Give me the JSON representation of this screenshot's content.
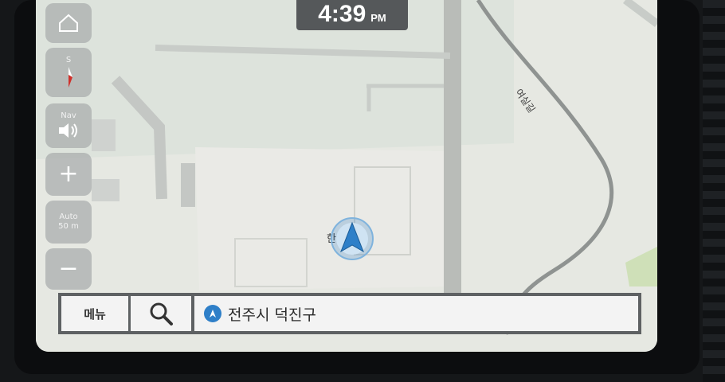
{
  "status_bar": {
    "time": "4:39",
    "ampm": "PM"
  },
  "controls": {
    "home_icon": "home-icon",
    "compass_label": "S",
    "nav_label": "Nav",
    "volume_icon": "speaker-icon",
    "zoom_in_symbol": "+",
    "zoom_mode": "Auto",
    "zoom_scale": "50 m",
    "zoom_out_symbol": "−"
  },
  "map": {
    "road_name": "여실길",
    "position_label": "한전"
  },
  "bottom_bar": {
    "menu_label": "메뉴",
    "search_icon": "search-icon",
    "current_location": "전주시 덕진구"
  },
  "colors": {
    "map_bg": "#e6e8e2",
    "road": "#8f9391",
    "vehicle": "#2e7fc8",
    "bar_bg": "#5e6163"
  }
}
